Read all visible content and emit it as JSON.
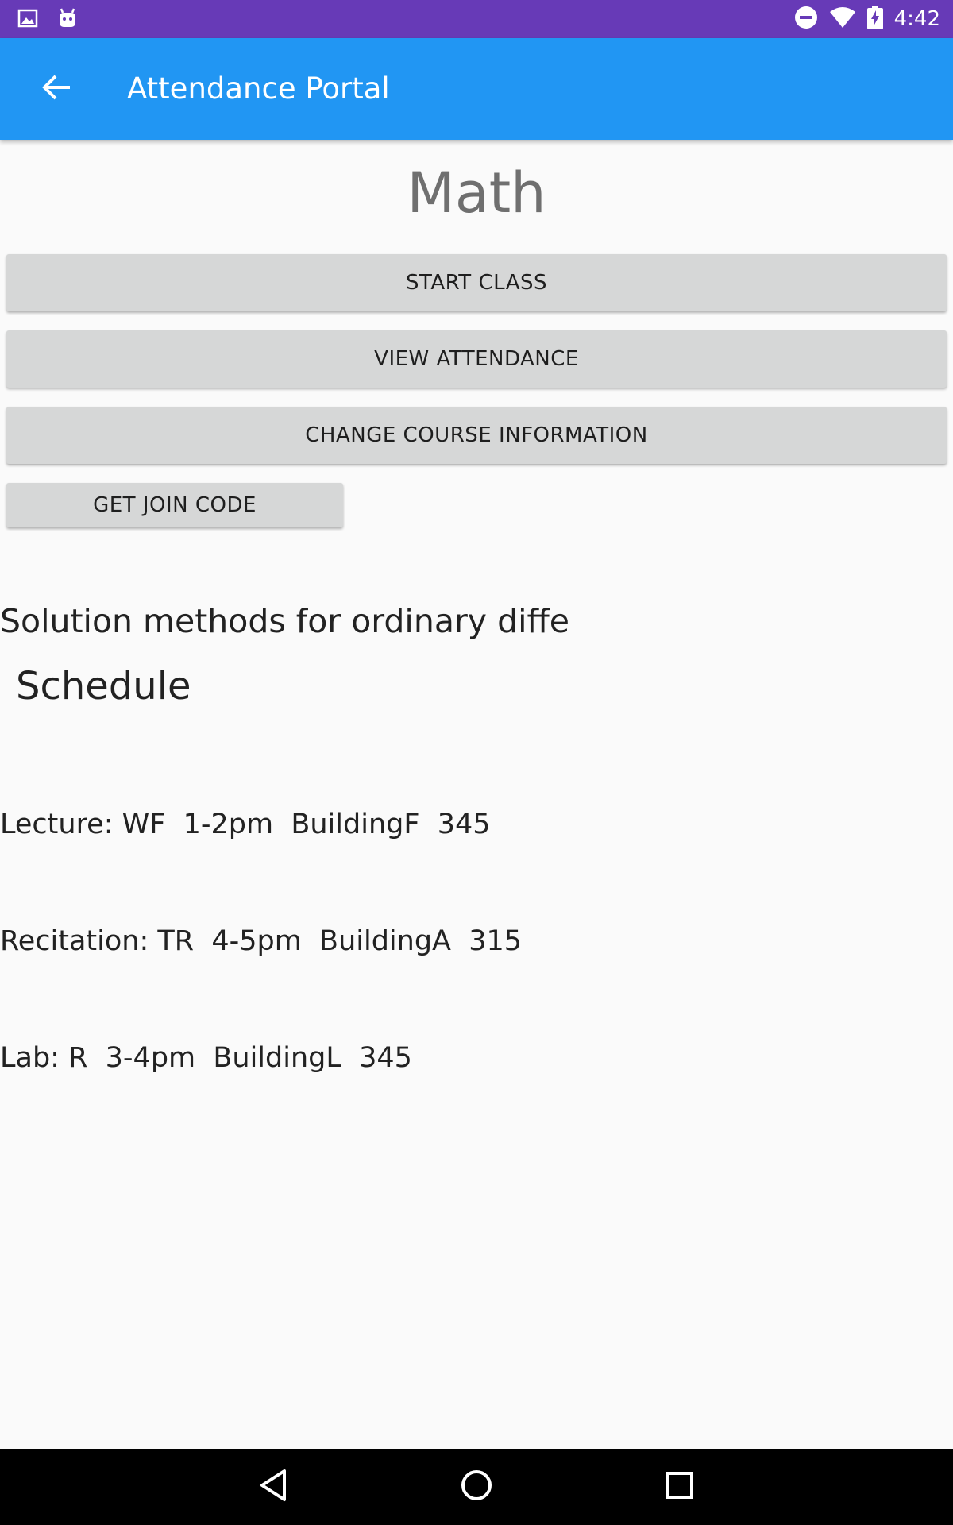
{
  "status_bar": {
    "time": "4:42",
    "left_icons": [
      "image-icon",
      "android-icon"
    ],
    "right_icons": [
      "do-not-disturb-icon",
      "wifi-icon",
      "battery-charging-icon"
    ],
    "background": "#673ab7"
  },
  "app_bar": {
    "title": "Attendance Portal",
    "background": "#2196f3",
    "back_icon": "arrow-back-icon"
  },
  "course": {
    "title": "Math",
    "description": "Solution methods for ordinary diffe"
  },
  "buttons": {
    "start_class": "START CLASS",
    "view_attendance": "VIEW ATTENDANCE",
    "change_course_information": "CHANGE COURSE INFORMATION",
    "get_join_code": "GET JOIN CODE"
  },
  "schedule": {
    "heading": "Schedule",
    "items": [
      "Lecture: WF  1-2pm  BuildingF  345",
      "Recitation: TR  4-5pm  BuildingA  315",
      "Lab: R  3-4pm  BuildingL  345"
    ]
  },
  "nav_bar": {
    "icons": [
      "nav-back-icon",
      "nav-home-icon",
      "nav-recents-icon"
    ]
  }
}
